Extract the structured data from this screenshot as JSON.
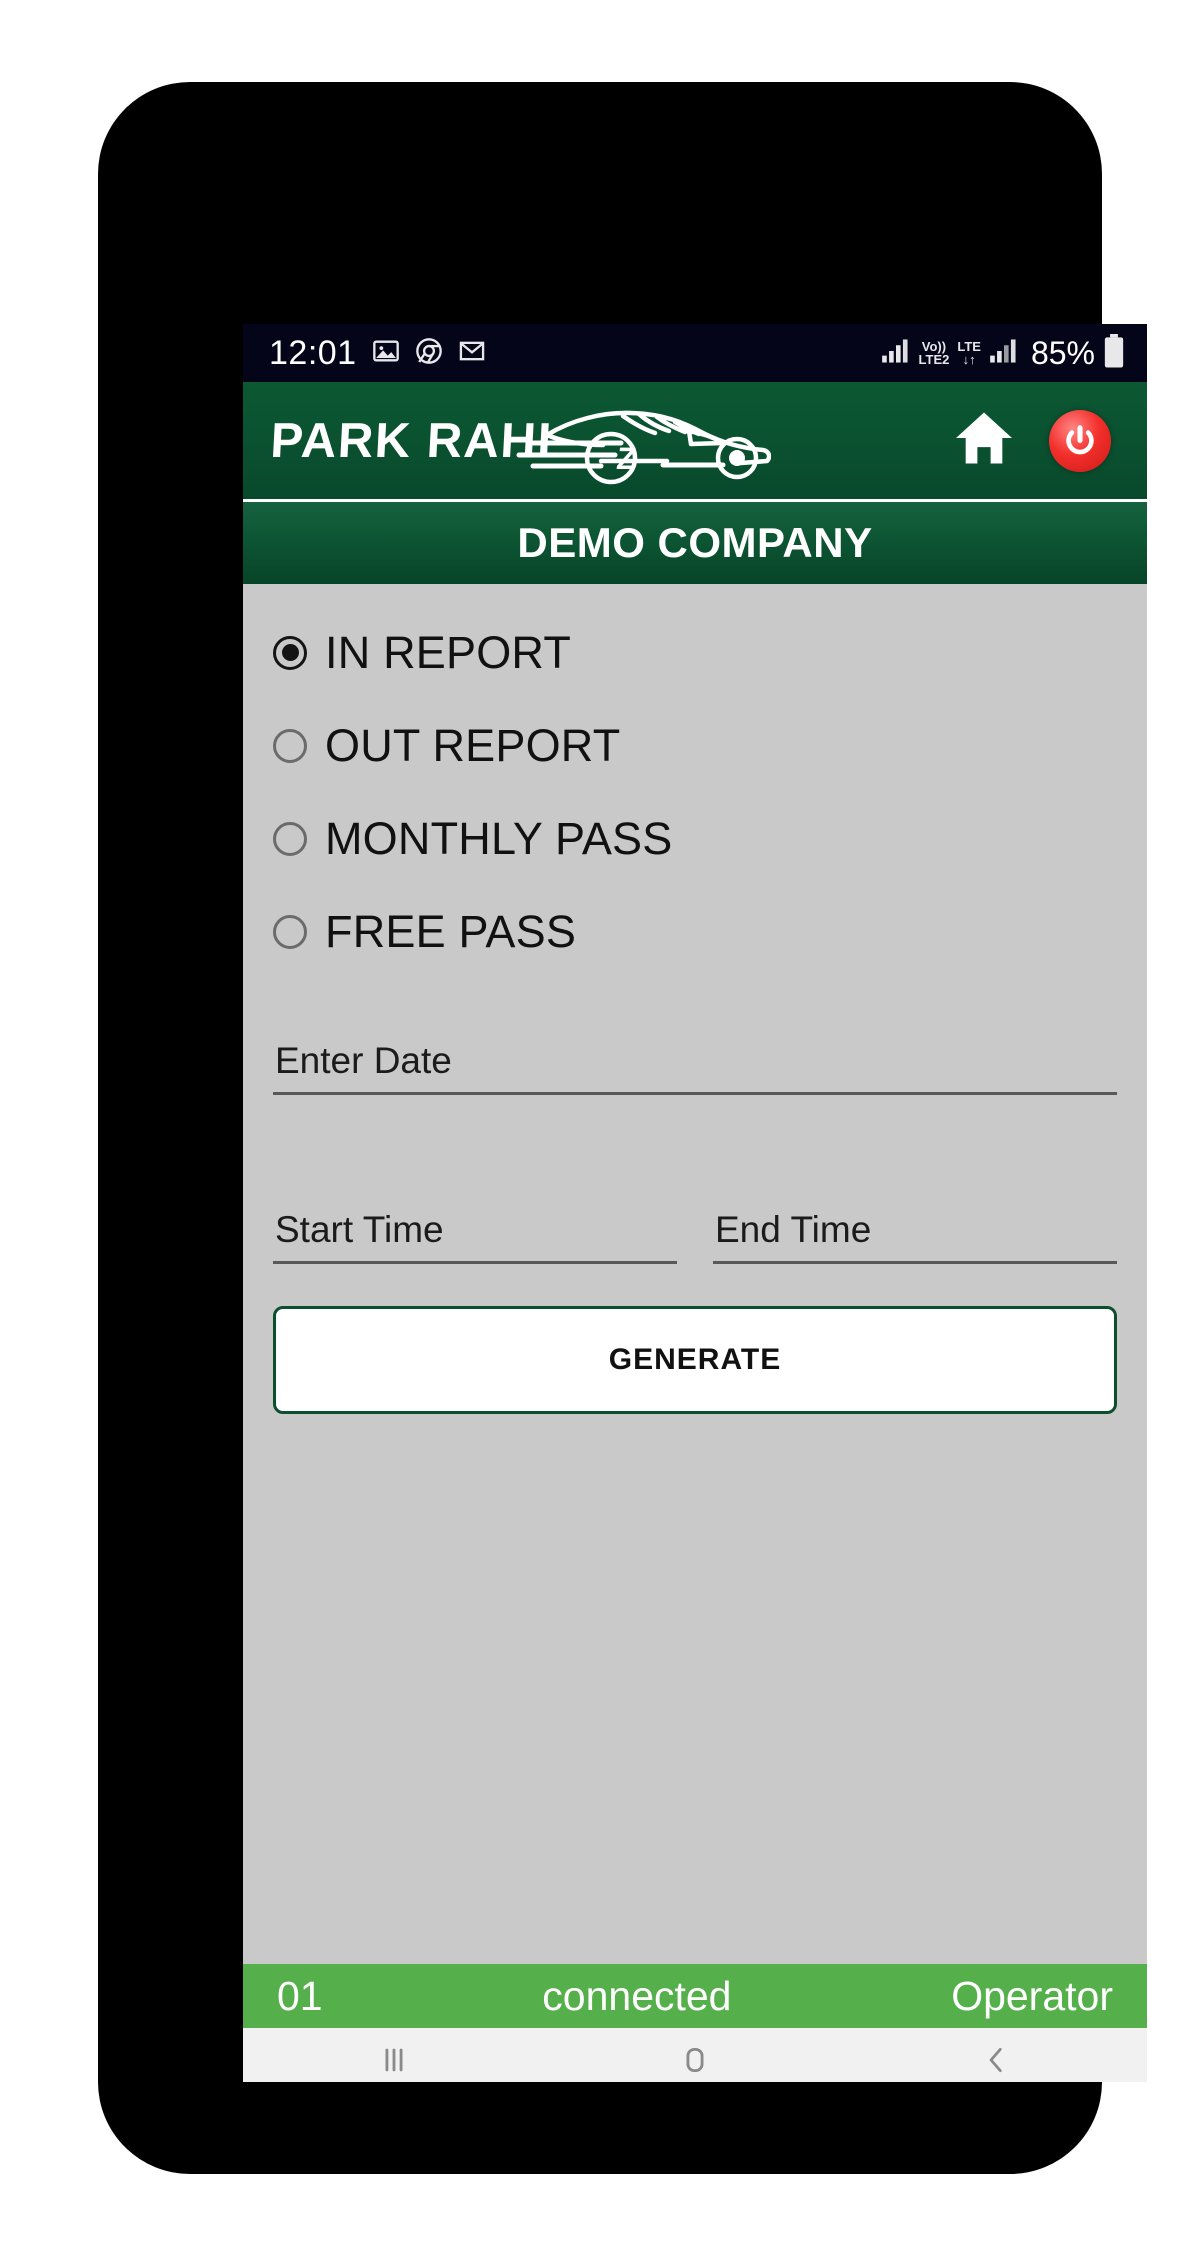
{
  "status_bar": {
    "time": "12:01",
    "icons": [
      "photos-icon",
      "chrome-icon",
      "gmail-icon"
    ],
    "network": {
      "volte_top": "Vo))",
      "volte_bottom": "LTE2",
      "lte_top": "LTE",
      "lte_bottom": "↓↑"
    },
    "battery_percent": "85%"
  },
  "header": {
    "logo_text": "PARK RAHI",
    "home_icon": "home-icon",
    "power_icon": "power-icon"
  },
  "company_bar": {
    "title": "DEMO COMPANY"
  },
  "report_options": [
    {
      "label": "IN REPORT",
      "selected": true
    },
    {
      "label": "OUT REPORT",
      "selected": false
    },
    {
      "label": "MONTHLY PASS",
      "selected": false
    },
    {
      "label": "FREE PASS",
      "selected": false
    }
  ],
  "fields": {
    "date": {
      "placeholder": "Enter Date",
      "value": ""
    },
    "start_time": {
      "placeholder": "Start Time",
      "value": ""
    },
    "end_time": {
      "placeholder": "End Time",
      "value": ""
    }
  },
  "actions": {
    "generate_label": "GENERATE"
  },
  "app_status": {
    "left": "01",
    "middle": "connected",
    "right": "Operator"
  },
  "nav_bar": {
    "recents": "recents-icon",
    "home": "home-square-icon",
    "back": "back-chevron-icon"
  },
  "colors": {
    "header_green": "#0b5431",
    "company_green": "#0d573f",
    "status_green": "#55b04b",
    "power_red": "#f3302c",
    "body_gray": "#c9c9c9"
  }
}
